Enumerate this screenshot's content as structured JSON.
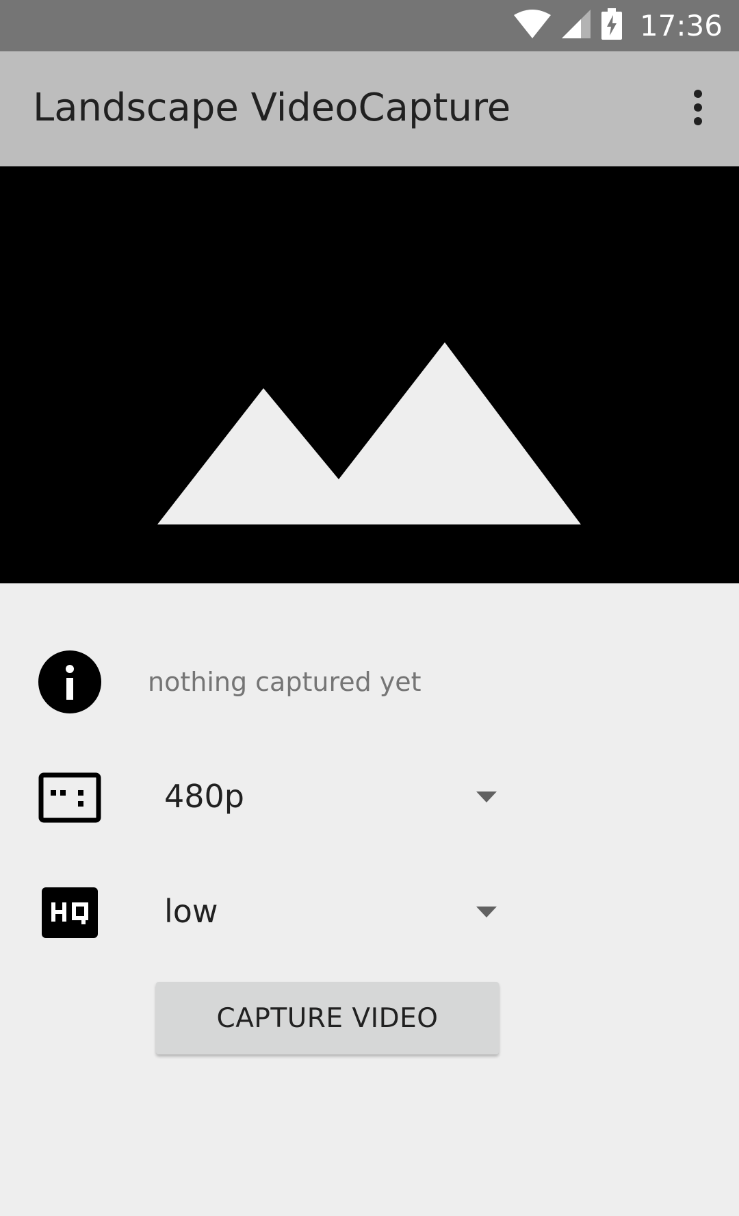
{
  "status_bar": {
    "time": "17:36",
    "icons": [
      "wifi-icon",
      "cellular-signal-icon",
      "battery-charging-icon"
    ]
  },
  "app_bar": {
    "title": "Landscape VideoCapture",
    "overflow_icon": "more-vert-icon"
  },
  "preview": {
    "icon": "image-placeholder-icon"
  },
  "info": {
    "icon": "info-icon",
    "text": "nothing captured yet"
  },
  "resolution": {
    "icon": "aspect-ratio-icon",
    "selected": "480p"
  },
  "quality": {
    "icon": "hq-icon",
    "selected": "low"
  },
  "capture_button": {
    "label": "CAPTURE VIDEO"
  },
  "colors": {
    "status_bar": "#757575",
    "app_bar": "#bdbdbd",
    "background": "#eeeeee",
    "preview_background": "#000000",
    "button": "#d6d7d7"
  }
}
